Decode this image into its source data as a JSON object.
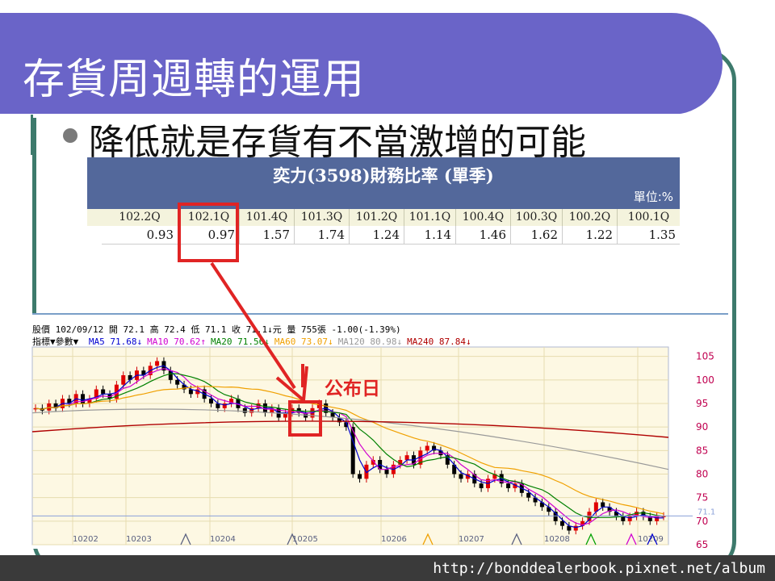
{
  "slide": {
    "title": "存貨周週轉的運用",
    "bullet": "降低就是存貨有不當激增的可能",
    "footer_url": "http://bonddealerbook.pixnet.net/album"
  },
  "colors": {
    "title_bg": "#6a64c8",
    "frame": "#3d7a6c",
    "table_head": "#53689b",
    "highlight": "#e02424"
  },
  "table": {
    "title": "奕力(3598)財務比率 (單季)",
    "unit": "單位:%",
    "quarters": [
      "102.2Q",
      "102.1Q",
      "101.4Q",
      "101.3Q",
      "101.2Q",
      "101.1Q",
      "100.4Q",
      "100.3Q",
      "100.2Q",
      "100.1Q"
    ],
    "values": [
      "0.93",
      "0.97",
      "1.57",
      "1.74",
      "1.24",
      "1.14",
      "1.46",
      "1.62",
      "1.22",
      "1.35"
    ],
    "highlight_index": 1
  },
  "chart": {
    "quote_line": "股價  102/09/12 開 72.1 高 72.4 低 71.1 收 71.1↓元 量 755張 -1.00(-1.39%)",
    "params_label": "指標▼參數▼",
    "ma": [
      {
        "label": "MA5 71.68↓",
        "color": "#0000d0"
      },
      {
        "label": "MA10 70.62↑",
        "color": "#d000d0"
      },
      {
        "label": "MA20 71.56↓",
        "color": "#008000"
      },
      {
        "label": "MA60 73.07↓",
        "color": "#f0a000"
      },
      {
        "label": "MA120 80.98↓",
        "color": "#999999"
      },
      {
        "label": "MA240 87.84↓",
        "color": "#b00000"
      }
    ],
    "announce_label": "公布日",
    "y_ticks": [
      "105",
      "100",
      "95",
      "90",
      "85",
      "80",
      "75",
      "70",
      "65"
    ],
    "y_range": [
      65,
      107
    ],
    "current_price_label": "71.1",
    "x_labels": [
      "10202",
      "10203",
      "10204",
      "10205",
      "10206",
      "10207",
      "10208",
      "10209"
    ],
    "annotated_x_labels": [
      "10202",
      "10203",
      "10204",
      "10205",
      "10206",
      "10207"
    ],
    "close_series": [
      94,
      93.5,
      95,
      94,
      96,
      95,
      97,
      95,
      96,
      98,
      97,
      96,
      99,
      101,
      100,
      102,
      101,
      103,
      104,
      102,
      100,
      99,
      98,
      97,
      98,
      96,
      95,
      94,
      95,
      96,
      94,
      93,
      94,
      95,
      93,
      94,
      92,
      93,
      94,
      93,
      92,
      94,
      95,
      93,
      92,
      91,
      90,
      80,
      79,
      82,
      83,
      81,
      80,
      82,
      83,
      84,
      82,
      85,
      86,
      85,
      84,
      82,
      80,
      79,
      80,
      78,
      77,
      79,
      80,
      78,
      77,
      78,
      76,
      75,
      74,
      73,
      72,
      70,
      69,
      68,
      69,
      70,
      72,
      74,
      73,
      72,
      71,
      70,
      71,
      72,
      71,
      70,
      71,
      71.1
    ]
  }
}
